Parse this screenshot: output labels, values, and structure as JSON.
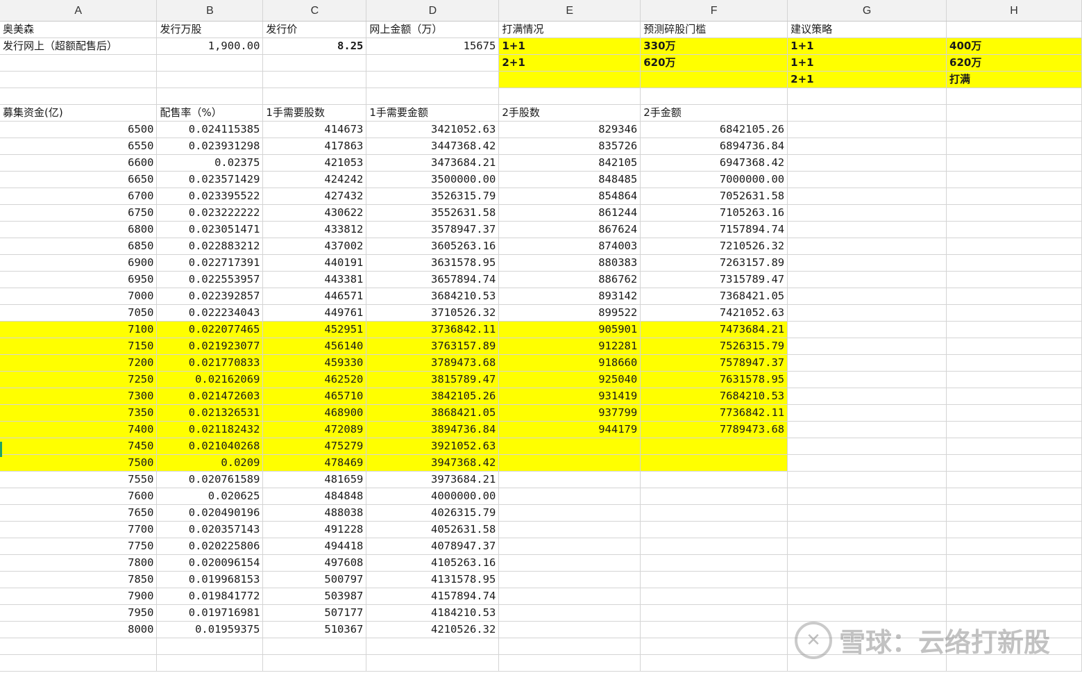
{
  "columns": [
    "A",
    "B",
    "C",
    "D",
    "E",
    "F",
    "G",
    "H"
  ],
  "header_rows": [
    {
      "A": "奥美森",
      "B": "发行万股",
      "C": "发行价",
      "D": "网上金额（万）",
      "E": "打满情况",
      "F": "预测碎股门槛",
      "G": "建议策略",
      "H": ""
    },
    {
      "A": "发行网上（超额配售后）",
      "B": "1,900.00",
      "C": "8.25",
      "D": "15675",
      "E": "1+1",
      "F": "330万",
      "G": "1+1",
      "H": "400万"
    },
    {
      "A": "",
      "B": "",
      "C": "",
      "D": "",
      "E": "2+1",
      "F": "620万",
      "G": "1+1",
      "H": "620万"
    },
    {
      "A": "",
      "B": "",
      "C": "",
      "D": "",
      "E": "",
      "F": "",
      "G": "2+1",
      "H": "打满"
    },
    {
      "A": "",
      "B": "",
      "C": "",
      "D": "",
      "E": "",
      "F": "",
      "G": "",
      "H": ""
    },
    {
      "A": "募集资金(亿)",
      "B": "配售率（%）",
      "C": "1手需要股数",
      "D": "1手需要金额",
      "E": "2手股数",
      "F": "2手金额",
      "G": "",
      "H": ""
    }
  ],
  "data_rows": [
    [
      "6500",
      "0.024115385",
      "414673",
      "3421052.63",
      "829346",
      "6842105.26"
    ],
    [
      "6550",
      "0.023931298",
      "417863",
      "3447368.42",
      "835726",
      "6894736.84"
    ],
    [
      "6600",
      "0.02375",
      "421053",
      "3473684.21",
      "842105",
      "6947368.42"
    ],
    [
      "6650",
      "0.023571429",
      "424242",
      "3500000.00",
      "848485",
      "7000000.00"
    ],
    [
      "6700",
      "0.023395522",
      "427432",
      "3526315.79",
      "854864",
      "7052631.58"
    ],
    [
      "6750",
      "0.023222222",
      "430622",
      "3552631.58",
      "861244",
      "7105263.16"
    ],
    [
      "6800",
      "0.023051471",
      "433812",
      "3578947.37",
      "867624",
      "7157894.74"
    ],
    [
      "6850",
      "0.022883212",
      "437002",
      "3605263.16",
      "874003",
      "7210526.32"
    ],
    [
      "6900",
      "0.022717391",
      "440191",
      "3631578.95",
      "880383",
      "7263157.89"
    ],
    [
      "6950",
      "0.022553957",
      "443381",
      "3657894.74",
      "886762",
      "7315789.47"
    ],
    [
      "7000",
      "0.022392857",
      "446571",
      "3684210.53",
      "893142",
      "7368421.05"
    ],
    [
      "7050",
      "0.022234043",
      "449761",
      "3710526.32",
      "899522",
      "7421052.63"
    ],
    [
      "7100",
      "0.022077465",
      "452951",
      "3736842.11",
      "905901",
      "7473684.21"
    ],
    [
      "7150",
      "0.021923077",
      "456140",
      "3763157.89",
      "912281",
      "7526315.79"
    ],
    [
      "7200",
      "0.021770833",
      "459330",
      "3789473.68",
      "918660",
      "7578947.37"
    ],
    [
      "7250",
      "0.02162069",
      "462520",
      "3815789.47",
      "925040",
      "7631578.95"
    ],
    [
      "7300",
      "0.021472603",
      "465710",
      "3842105.26",
      "931419",
      "7684210.53"
    ],
    [
      "7350",
      "0.021326531",
      "468900",
      "3868421.05",
      "937799",
      "7736842.11"
    ],
    [
      "7400",
      "0.021182432",
      "472089",
      "3894736.84",
      "944179",
      "7789473.68"
    ],
    [
      "7450",
      "0.021040268",
      "475279",
      "3921052.63",
      "",
      ""
    ],
    [
      "7500",
      "0.0209",
      "478469",
      "3947368.42",
      "",
      ""
    ],
    [
      "7550",
      "0.020761589",
      "481659",
      "3973684.21",
      "",
      ""
    ],
    [
      "7600",
      "0.020625",
      "484848",
      "4000000.00",
      "",
      ""
    ],
    [
      "7650",
      "0.020490196",
      "488038",
      "4026315.79",
      "",
      ""
    ],
    [
      "7700",
      "0.020357143",
      "491228",
      "4052631.58",
      "",
      ""
    ],
    [
      "7750",
      "0.020225806",
      "494418",
      "4078947.37",
      "",
      ""
    ],
    [
      "7800",
      "0.020096154",
      "497608",
      "4105263.16",
      "",
      ""
    ],
    [
      "7850",
      "0.019968153",
      "500797",
      "4131578.95",
      "",
      ""
    ],
    [
      "7900",
      "0.019841772",
      "503987",
      "4157894.74",
      "",
      ""
    ],
    [
      "7950",
      "0.019716981",
      "507177",
      "4184210.53",
      "",
      ""
    ],
    [
      "8000",
      "0.01959375",
      "510367",
      "4210526.32",
      "",
      ""
    ]
  ],
  "highlight_rows_range": [
    "7100",
    "7500"
  ],
  "highlight_color": "#ffff00",
  "watermark": {
    "logo_glyph": "✕",
    "text": "雪球：云络打新股"
  }
}
